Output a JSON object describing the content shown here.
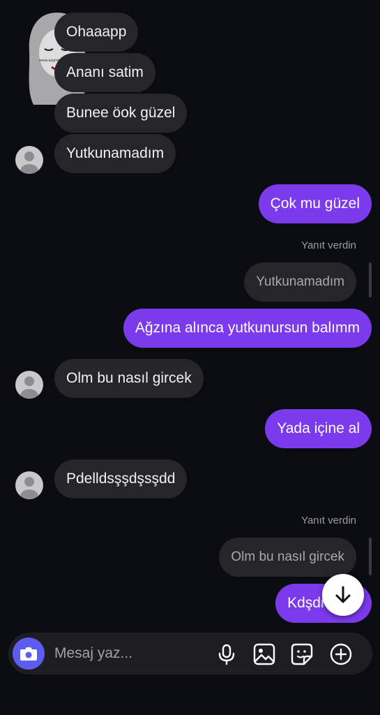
{
  "watermark": {
    "text": "www.azginkizlar.com"
  },
  "messages": {
    "m1": "Ohaaapp",
    "m2": "Ananı satim",
    "m3": "Bunee öok güzel",
    "m4": "Yutkunamadım",
    "m5": "Çok mu güzel",
    "reply1_label": "Yanıt verdin",
    "reply1_quote": "Yutkunamadım",
    "m6": "Ağzına alınca yutkunursun balımm",
    "m7": "Olm bu nasıl gircek",
    "m8": "Yada içine al",
    "m9": "Pdelldsşşdşsşdd",
    "reply2_label": "Yanıt verdin",
    "reply2_quote": "Olm bu nasıl gircek",
    "m10": "Kdşdmdşsı"
  },
  "composer": {
    "placeholder": "Mesaj yaz..."
  },
  "icons": [
    "camera-icon",
    "microphone-icon",
    "image-icon",
    "sticker-icon",
    "plus-circle-icon",
    "arrow-down-icon"
  ],
  "colors": {
    "background": "#0b0b12",
    "incoming_bubble": "#262629",
    "outgoing_bubble": "#7c3aed",
    "camera_button": "#5b5cf0"
  }
}
